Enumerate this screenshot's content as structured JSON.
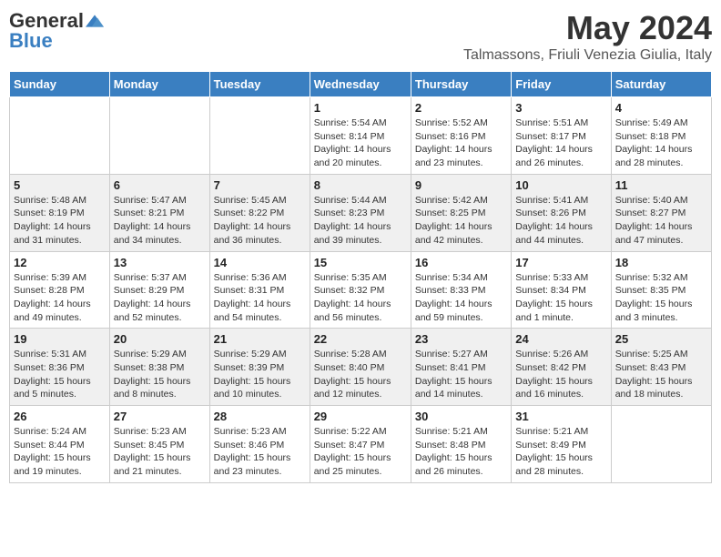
{
  "header": {
    "logo_general": "General",
    "logo_blue": "Blue",
    "month_title": "May 2024",
    "location": "Talmassons, Friuli Venezia Giulia, Italy"
  },
  "days_of_week": [
    "Sunday",
    "Monday",
    "Tuesday",
    "Wednesday",
    "Thursday",
    "Friday",
    "Saturday"
  ],
  "weeks": [
    [
      {
        "day": "",
        "info": ""
      },
      {
        "day": "",
        "info": ""
      },
      {
        "day": "",
        "info": ""
      },
      {
        "day": "1",
        "info": "Sunrise: 5:54 AM\nSunset: 8:14 PM\nDaylight: 14 hours\nand 20 minutes."
      },
      {
        "day": "2",
        "info": "Sunrise: 5:52 AM\nSunset: 8:16 PM\nDaylight: 14 hours\nand 23 minutes."
      },
      {
        "day": "3",
        "info": "Sunrise: 5:51 AM\nSunset: 8:17 PM\nDaylight: 14 hours\nand 26 minutes."
      },
      {
        "day": "4",
        "info": "Sunrise: 5:49 AM\nSunset: 8:18 PM\nDaylight: 14 hours\nand 28 minutes."
      }
    ],
    [
      {
        "day": "5",
        "info": "Sunrise: 5:48 AM\nSunset: 8:19 PM\nDaylight: 14 hours\nand 31 minutes."
      },
      {
        "day": "6",
        "info": "Sunrise: 5:47 AM\nSunset: 8:21 PM\nDaylight: 14 hours\nand 34 minutes."
      },
      {
        "day": "7",
        "info": "Sunrise: 5:45 AM\nSunset: 8:22 PM\nDaylight: 14 hours\nand 36 minutes."
      },
      {
        "day": "8",
        "info": "Sunrise: 5:44 AM\nSunset: 8:23 PM\nDaylight: 14 hours\nand 39 minutes."
      },
      {
        "day": "9",
        "info": "Sunrise: 5:42 AM\nSunset: 8:25 PM\nDaylight: 14 hours\nand 42 minutes."
      },
      {
        "day": "10",
        "info": "Sunrise: 5:41 AM\nSunset: 8:26 PM\nDaylight: 14 hours\nand 44 minutes."
      },
      {
        "day": "11",
        "info": "Sunrise: 5:40 AM\nSunset: 8:27 PM\nDaylight: 14 hours\nand 47 minutes."
      }
    ],
    [
      {
        "day": "12",
        "info": "Sunrise: 5:39 AM\nSunset: 8:28 PM\nDaylight: 14 hours\nand 49 minutes."
      },
      {
        "day": "13",
        "info": "Sunrise: 5:37 AM\nSunset: 8:29 PM\nDaylight: 14 hours\nand 52 minutes."
      },
      {
        "day": "14",
        "info": "Sunrise: 5:36 AM\nSunset: 8:31 PM\nDaylight: 14 hours\nand 54 minutes."
      },
      {
        "day": "15",
        "info": "Sunrise: 5:35 AM\nSunset: 8:32 PM\nDaylight: 14 hours\nand 56 minutes."
      },
      {
        "day": "16",
        "info": "Sunrise: 5:34 AM\nSunset: 8:33 PM\nDaylight: 14 hours\nand 59 minutes."
      },
      {
        "day": "17",
        "info": "Sunrise: 5:33 AM\nSunset: 8:34 PM\nDaylight: 15 hours\nand 1 minute."
      },
      {
        "day": "18",
        "info": "Sunrise: 5:32 AM\nSunset: 8:35 PM\nDaylight: 15 hours\nand 3 minutes."
      }
    ],
    [
      {
        "day": "19",
        "info": "Sunrise: 5:31 AM\nSunset: 8:36 PM\nDaylight: 15 hours\nand 5 minutes."
      },
      {
        "day": "20",
        "info": "Sunrise: 5:29 AM\nSunset: 8:38 PM\nDaylight: 15 hours\nand 8 minutes."
      },
      {
        "day": "21",
        "info": "Sunrise: 5:29 AM\nSunset: 8:39 PM\nDaylight: 15 hours\nand 10 minutes."
      },
      {
        "day": "22",
        "info": "Sunrise: 5:28 AM\nSunset: 8:40 PM\nDaylight: 15 hours\nand 12 minutes."
      },
      {
        "day": "23",
        "info": "Sunrise: 5:27 AM\nSunset: 8:41 PM\nDaylight: 15 hours\nand 14 minutes."
      },
      {
        "day": "24",
        "info": "Sunrise: 5:26 AM\nSunset: 8:42 PM\nDaylight: 15 hours\nand 16 minutes."
      },
      {
        "day": "25",
        "info": "Sunrise: 5:25 AM\nSunset: 8:43 PM\nDaylight: 15 hours\nand 18 minutes."
      }
    ],
    [
      {
        "day": "26",
        "info": "Sunrise: 5:24 AM\nSunset: 8:44 PM\nDaylight: 15 hours\nand 19 minutes."
      },
      {
        "day": "27",
        "info": "Sunrise: 5:23 AM\nSunset: 8:45 PM\nDaylight: 15 hours\nand 21 minutes."
      },
      {
        "day": "28",
        "info": "Sunrise: 5:23 AM\nSunset: 8:46 PM\nDaylight: 15 hours\nand 23 minutes."
      },
      {
        "day": "29",
        "info": "Sunrise: 5:22 AM\nSunset: 8:47 PM\nDaylight: 15 hours\nand 25 minutes."
      },
      {
        "day": "30",
        "info": "Sunrise: 5:21 AM\nSunset: 8:48 PM\nDaylight: 15 hours\nand 26 minutes."
      },
      {
        "day": "31",
        "info": "Sunrise: 5:21 AM\nSunset: 8:49 PM\nDaylight: 15 hours\nand 28 minutes."
      },
      {
        "day": "",
        "info": ""
      }
    ]
  ]
}
